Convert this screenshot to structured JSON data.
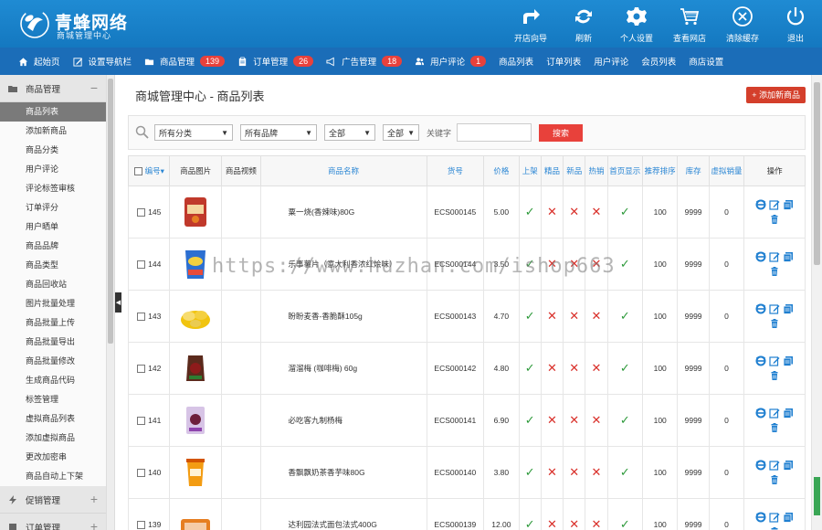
{
  "header": {
    "brand": "青蜂网络",
    "subtitle": "商城管理中心",
    "actions": [
      {
        "label": "开店向导",
        "icon": "share-arrow-icon"
      },
      {
        "label": "刷新",
        "icon": "refresh-icon"
      },
      {
        "label": "个人设置",
        "icon": "gear-icon"
      },
      {
        "label": "查看网店",
        "icon": "cart-icon"
      },
      {
        "label": "清除缓存",
        "icon": "close-circle-icon"
      },
      {
        "label": "退出",
        "icon": "power-icon"
      }
    ]
  },
  "navbar": {
    "items": [
      {
        "label": "起始页",
        "icon": "home-icon"
      },
      {
        "label": "设置导航栏",
        "icon": "edit-icon"
      },
      {
        "label": "商品管理",
        "icon": "folder-icon",
        "badge": "139"
      },
      {
        "label": "订单管理",
        "icon": "clipboard-icon",
        "badge": "26"
      },
      {
        "label": "广告管理",
        "icon": "megaphone-icon",
        "badge": "18"
      },
      {
        "label": "用户评论",
        "icon": "users-icon",
        "badge": "1"
      },
      {
        "label": "商品列表"
      },
      {
        "label": "订单列表"
      },
      {
        "label": "用户评论"
      },
      {
        "label": "会员列表"
      },
      {
        "label": "商店设置"
      }
    ]
  },
  "sidebar": {
    "group1": {
      "label": "商品管理",
      "toggle": "−",
      "icon": "folder-icon"
    },
    "items": [
      "商品列表",
      "添加新商品",
      "商品分类",
      "用户评论",
      "评论标签审核",
      "订单评分",
      "用户晒单",
      "商品品牌",
      "商品类型",
      "商品回收站",
      "图片批量处理",
      "商品批量上传",
      "商品批量导出",
      "商品批量修改",
      "生成商品代码",
      "标签管理",
      "虚拟商品列表",
      "添加虚拟商品",
      "更改加密串",
      "商品自动上下架"
    ],
    "active_index": 0,
    "group2": {
      "label": "促销管理",
      "toggle": "+",
      "icon": "bolt-icon"
    },
    "group3": {
      "label": "订单管理",
      "toggle": "+",
      "icon": "clipboard-icon"
    }
  },
  "main": {
    "title": "商城管理中心 - 商品列表",
    "add_button": "+ 添加新商品",
    "filters": {
      "category": "所有分类",
      "brand": "所有品牌",
      "type": "全部",
      "status": "全部",
      "keyword_label": "关键字",
      "keyword_value": "",
      "search_button": "搜索"
    },
    "columns": [
      "编号",
      "商品图片",
      "商品视频",
      "商品名称",
      "货号",
      "价格",
      "上架",
      "精品",
      "新品",
      "热销",
      "首页显示",
      "推荐排序",
      "库存",
      "虚拟销量",
      "操作"
    ],
    "sort_indicator": "▾",
    "rows": [
      {
        "id": "145",
        "name": "粟一烧(香辣味)80G",
        "sn": "ECS000145",
        "price": "5.00",
        "onsale": true,
        "best": false,
        "new": false,
        "hot": false,
        "home": true,
        "sort": "100",
        "stock": "9999",
        "virtual": "0",
        "img": "snack-bag-red"
      },
      {
        "id": "144",
        "name": "乐事薯片（意大利香浓红烩味）",
        "sn": "ECS000144",
        "price": "3.50",
        "onsale": true,
        "best": false,
        "new": false,
        "hot": false,
        "home": true,
        "sort": "100",
        "stock": "9999",
        "virtual": "0",
        "img": "chips-bag"
      },
      {
        "id": "143",
        "name": "盼盼麦香-香脆酥105g",
        "sn": "ECS000143",
        "price": "4.70",
        "onsale": true,
        "best": false,
        "new": false,
        "hot": false,
        "home": true,
        "sort": "100",
        "stock": "9999",
        "virtual": "0",
        "img": "crisps-pile"
      },
      {
        "id": "142",
        "name": "溜溜梅 (咖啡梅) 60g",
        "sn": "ECS000142",
        "price": "4.80",
        "onsale": true,
        "best": false,
        "new": false,
        "hot": false,
        "home": true,
        "sort": "100",
        "stock": "9999",
        "virtual": "0",
        "img": "plum-bag"
      },
      {
        "id": "141",
        "name": "必吃客九制杨梅",
        "sn": "ECS000141",
        "price": "6.90",
        "onsale": true,
        "best": false,
        "new": false,
        "hot": false,
        "home": true,
        "sort": "100",
        "stock": "9999",
        "virtual": "0",
        "img": "bayberry-bag"
      },
      {
        "id": "140",
        "name": "香飘飘奶茶香芋味80G",
        "sn": "ECS000140",
        "price": "3.80",
        "onsale": true,
        "best": false,
        "new": false,
        "hot": false,
        "home": true,
        "sort": "100",
        "stock": "9999",
        "virtual": "0",
        "img": "milk-tea-cup"
      },
      {
        "id": "139",
        "name": "达利园法式面包法式400G",
        "sn": "ECS000139",
        "price": "12.00",
        "onsale": true,
        "best": false,
        "new": false,
        "hot": false,
        "home": true,
        "sort": "100",
        "stock": "9999",
        "virtual": "0",
        "img": "bread-pack"
      }
    ]
  },
  "colors": {
    "header": "#1478c0",
    "navbar": "#1b6db8",
    "badge": "#e8413b",
    "check": "#2e9a3b",
    "cross": "#d9302a",
    "link": "#2a86d4"
  },
  "watermark": "https://www.huzhan.com/ishop663"
}
